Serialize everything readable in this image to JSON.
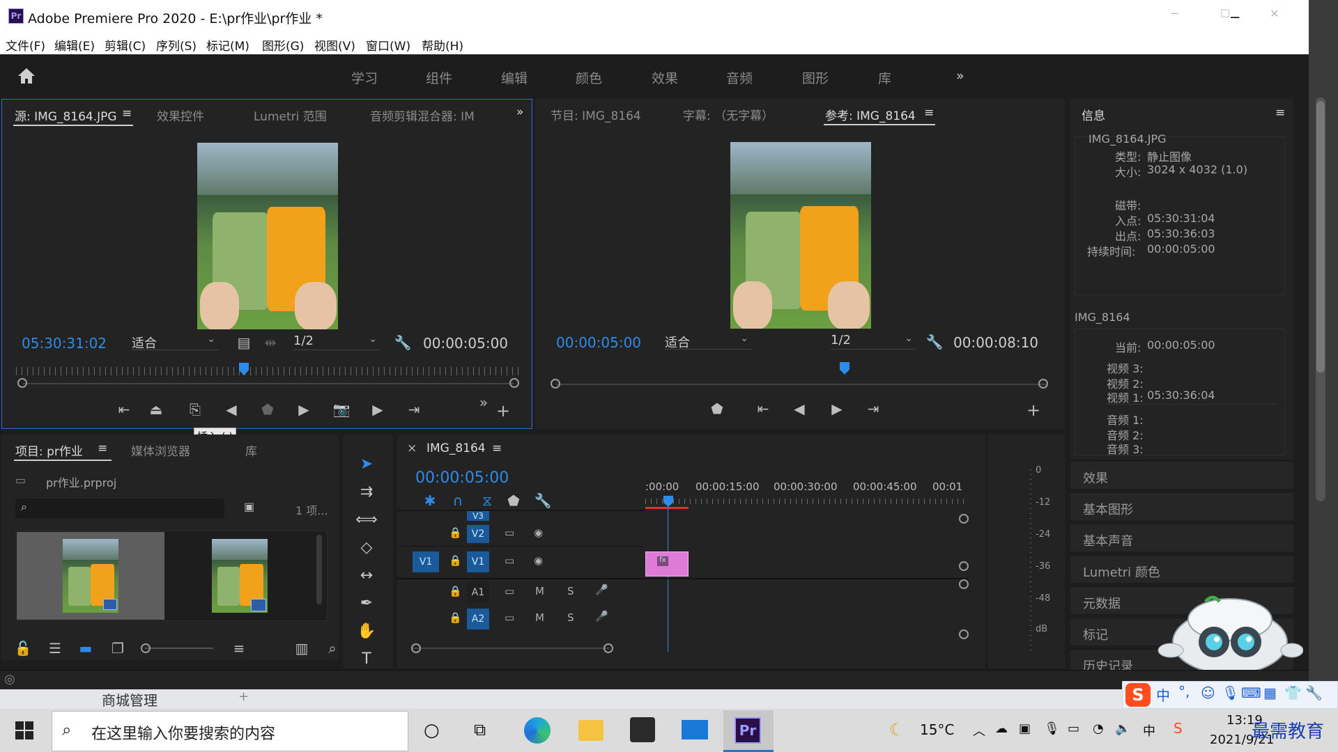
{
  "window": {
    "title": "Adobe Premiere Pro 2020 - E:\\pr作业\\pr作业 *",
    "app_logo": "Pr",
    "controls": [
      "─",
      "☐",
      "✕"
    ]
  },
  "menu": [
    "文件(F)",
    "编辑(E)",
    "剪辑(C)",
    "序列(S)",
    "标记(M)",
    "图形(G)",
    "视图(V)",
    "窗口(W)",
    "帮助(H)"
  ],
  "workspaces": [
    "学习",
    "组件",
    "编辑",
    "颜色",
    "效果",
    "音频",
    "图形",
    "库"
  ],
  "source_panel": {
    "tabs": [
      "源: IMG_8164.JPG",
      "效果控件",
      "Lumetri 范围",
      "音频剪辑混合器: IM"
    ],
    "timecode": "05:30:31:02",
    "fit": "适合",
    "resolution": "1/2",
    "duration": "00:00:05:00",
    "tooltip": "插入 (,)"
  },
  "program_panel": {
    "tabs": [
      "节目: IMG_8164",
      "字幕: （无字幕）",
      "参考: IMG_8164"
    ],
    "timecode": "00:00:05:00",
    "fit": "适合",
    "resolution": "1/2",
    "duration": "00:00:08:10"
  },
  "info_panel": {
    "title": "信息",
    "filename": "IMG_8164.JPG",
    "type_label": "类型:",
    "type_value": "静止图像",
    "size_label": "大小:",
    "size_value": "3024 x 4032 (1.0)",
    "tape_label": "磁带:",
    "in_label": "入点:",
    "in_value": "05:30:31:04",
    "out_label": "出点:",
    "out_value": "05:30:36:03",
    "dur_label": "持续时间:",
    "dur_value": "00:00:05:00",
    "seq_name": "IMG_8164",
    "current_label": "当前:",
    "current_value": "00:00:05:00",
    "v3_label": "视频 3:",
    "v2_label": "视频 2:",
    "v1_label": "视频 1:",
    "v1_value": "05:30:36:04",
    "a1_label": "音频 1:",
    "a2_label": "音频 2:",
    "a3_label": "音频 3:"
  },
  "right_panels": [
    "效果",
    "基本图形",
    "基本声音",
    "Lumetri 颜色",
    "元数据",
    "标记",
    "历史记录"
  ],
  "project_panel": {
    "tabs": [
      "项目: pr作业",
      "媒体浏览器",
      "库"
    ],
    "project_file": "pr作业.prproj",
    "item_count": "1 项..."
  },
  "timeline": {
    "sequence_name": "IMG_8164",
    "timecode": "00:00:05:00",
    "ruler_labels": [
      ":00:00",
      "00:00:15:00",
      "00:00:30:00",
      "00:00:45:00",
      "00:01"
    ],
    "tracks": {
      "v3": "V3",
      "v2": "V2",
      "v1": "V1",
      "src_v1": "V1",
      "a1": "A1",
      "a2": "A2",
      "m": "M",
      "s": "S"
    },
    "meter_labels": [
      "0",
      "-12",
      "-24",
      "-36",
      "-48",
      "dB"
    ]
  },
  "taskbar": {
    "search_placeholder": "在这里输入你要搜索的内容",
    "temperature": "15°C",
    "time": "13:19",
    "date": "2021/9/21",
    "ime": "中",
    "watermark": "最需教育"
  },
  "behind_window": {
    "text": "商城管理"
  },
  "colors": {
    "accent_blue": "#2d8ceb",
    "clip_pink": "#e07ad8",
    "playhead_red": "#e03030"
  }
}
